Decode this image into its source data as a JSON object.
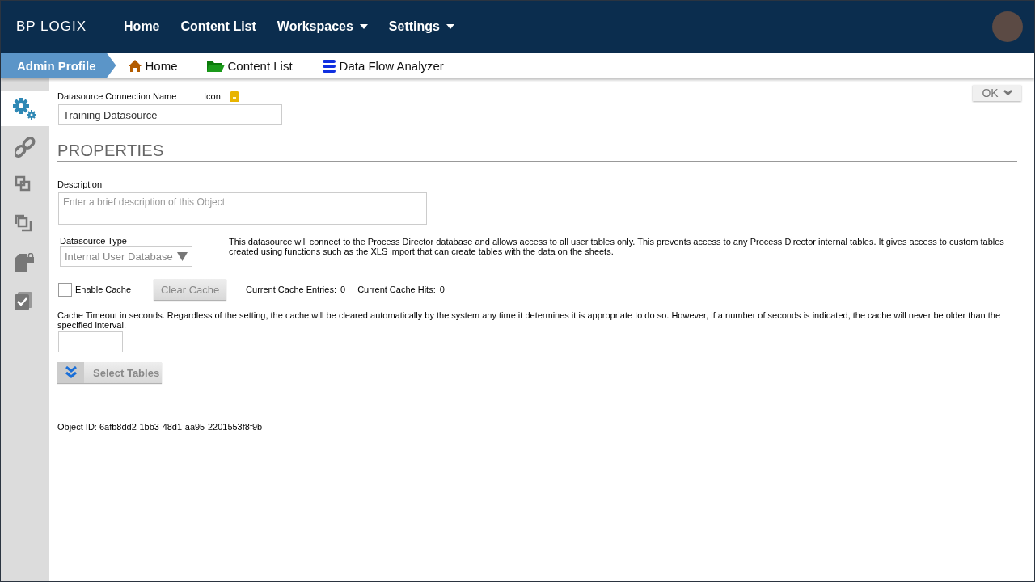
{
  "topbar": {
    "logo": "BP LOGIX",
    "nav": [
      {
        "label": "Home",
        "dropdown": false
      },
      {
        "label": "Content List",
        "dropdown": false
      },
      {
        "label": "Workspaces",
        "dropdown": true
      },
      {
        "label": "Settings",
        "dropdown": true
      }
    ]
  },
  "breadcrumb": {
    "profile": "Admin Profile",
    "links": [
      {
        "label": "Home",
        "kind": "home"
      },
      {
        "label": "Content List",
        "kind": "folder"
      },
      {
        "label": "Data Flow Analyzer",
        "kind": "database"
      }
    ]
  },
  "sidebar": {
    "items": [
      {
        "kind": "gears",
        "selected": true
      },
      {
        "kind": "link",
        "selected": false
      },
      {
        "kind": "squares",
        "selected": false
      },
      {
        "kind": "stack",
        "selected": false
      },
      {
        "kind": "lockdoc",
        "selected": false
      },
      {
        "kind": "checkdoc",
        "selected": false
      }
    ]
  },
  "ok_button": "OK",
  "form": {
    "name_label": "Datasource Connection Name",
    "icon_label": "Icon",
    "name_value": "Training Datasource",
    "section_title": "PROPERTIES",
    "description_label": "Description",
    "description_placeholder": "Enter a brief description of this Object",
    "type_label": "Datasource Type",
    "type_value": "Internal User Database",
    "type_note": "This datasource will connect to the Process Director database and allows access to all user tables only. This prevents access to any Process Director internal tables. It gives access to custom tables created using functions such as the XLS import that can create tables with the data on the sheets.",
    "enable_cache": {
      "label": "Enable Cache",
      "checked": false
    },
    "clear_cache": {
      "label": "Clear Cache",
      "disabled": true
    },
    "stats": [
      {
        "label": "Current Cache Entries:",
        "value": "0"
      },
      {
        "label": "Current Cache Hits:",
        "value": "0"
      }
    ],
    "timeout_note": "Cache Timeout in seconds. Regardless of the setting, the cache will be cleared automatically by the system any time it determines it is appropriate to do so. However, if a number of seconds is indicated, the cache will never be older than the specified interval.",
    "select_tables": "Select Tables",
    "object_id": "Object ID: 6afb8dd2-1bb3-48d1-aa95-2201553f8f9b"
  }
}
